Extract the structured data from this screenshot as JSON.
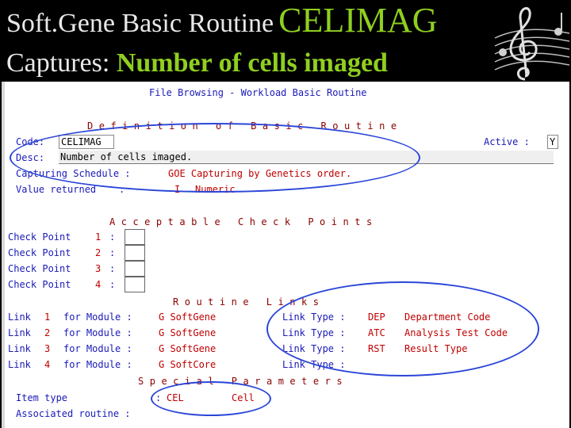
{
  "slide": {
    "title_line1_prefix": "Soft.Gene Basic Routine",
    "title_line1_code": "CELIMAG",
    "title_line2_prefix": "Captures:",
    "title_line2_value": "Number of cells imaged",
    "logo_icon": "treble-clef-icon"
  },
  "window": {
    "header": "File Browsing - Workload Basic Routine"
  },
  "definition": {
    "section_title": "Definition of Basic Routine",
    "code_label": "Code:",
    "code_value": "CELIMAG",
    "active_label": "Active :",
    "active_value": "Y",
    "desc_label": "Desc:",
    "desc_value": "Number of cells imaged.",
    "schedule_label": "Capturing Schedule :",
    "schedule_value": "GOE Capturing by Genetics order.",
    "value_returned_label": "Value returned    :",
    "value_returned_code": "I",
    "value_returned_text": "Numeric"
  },
  "checkpoints": {
    "section_title": "Acceptable Check Points",
    "items": [
      {
        "label": "Check Point",
        "num": "1",
        "colon": ":"
      },
      {
        "label": "Check Point",
        "num": "2",
        "colon": ":"
      },
      {
        "label": "Check Point",
        "num": "3",
        "colon": ":"
      },
      {
        "label": "Check Point",
        "num": "4",
        "colon": ":"
      }
    ]
  },
  "links": {
    "section_title": "Routine Links",
    "rows": [
      {
        "label": "Link",
        "num": "1",
        "for": "for Module :",
        "module": "G SoftGene",
        "type_label": "Link Type :",
        "type_code": "DEP",
        "type_desc": "Department Code"
      },
      {
        "label": "Link",
        "num": "2",
        "for": "for Module :",
        "module": "G SoftGene",
        "type_label": "Link Type :",
        "type_code": "ATC",
        "type_desc": "Analysis Test Code"
      },
      {
        "label": "Link",
        "num": "3",
        "for": "for Module :",
        "module": "G SoftGene",
        "type_label": "Link Type :",
        "type_code": "RST",
        "type_desc": "Result Type"
      },
      {
        "label": "Link",
        "num": "4",
        "for": "for Module :",
        "module": "G SoftCore",
        "type_label": "Link Type :",
        "type_code": "",
        "type_desc": ""
      }
    ]
  },
  "special": {
    "section_title": "Special Parameters",
    "item_type_label": "Item type",
    "item_type_colon": ":",
    "item_type_code": "CEL",
    "item_type_text": "Cell",
    "assoc_label": "Associated routine :"
  },
  "colors": {
    "title_accent": "#8fcf1f",
    "label_blue": "#1a1ab8",
    "value_red": "#c00000",
    "highlight_oval": "#2b46d8"
  }
}
